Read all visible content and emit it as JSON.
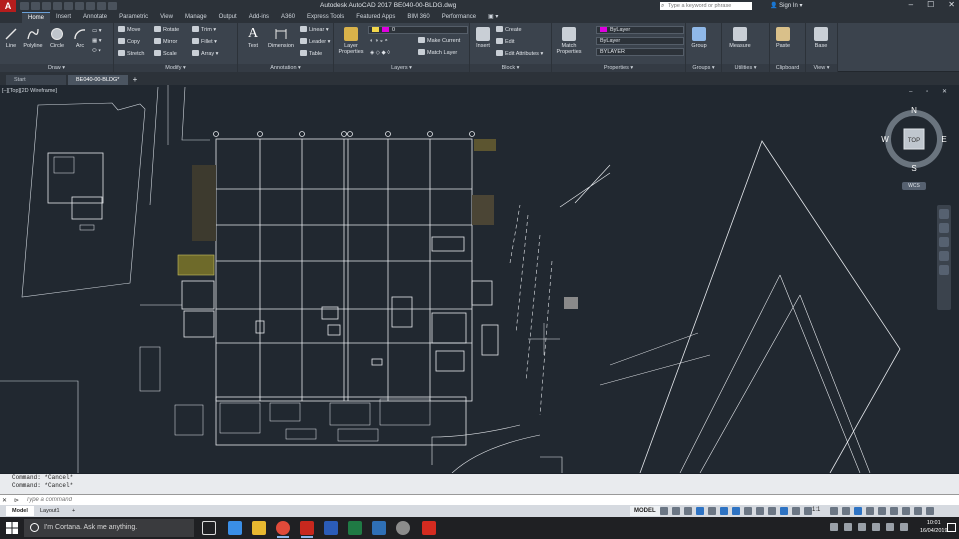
{
  "app": {
    "title": "Autodesk AutoCAD 2017   BE040-00-BLDG.dwg",
    "logo_letter": "A",
    "search_placeholder": "Type a keyword or phrase",
    "sign_in": "Sign In",
    "window_controls": [
      "–",
      "☐",
      "✕"
    ]
  },
  "ribbon_tabs": [
    "Home",
    "Insert",
    "Annotate",
    "Parametric",
    "View",
    "Manage",
    "Output",
    "Add-ins",
    "A360",
    "Express Tools",
    "Featured Apps",
    "BIM 360",
    "Performance",
    "▣ ▾"
  ],
  "ribbon_active_tab": "Home",
  "panels": {
    "draw": {
      "title": "Draw ▾",
      "tools": [
        "Line",
        "Polyline",
        "Circle",
        "Arc"
      ]
    },
    "modify": {
      "title": "Modify ▾",
      "tools": [
        "Move",
        "Rotate",
        "Trim",
        "Copy",
        "Mirror",
        "Fillet",
        "Stretch",
        "Scale",
        "Array"
      ]
    },
    "annotation": {
      "title": "Annotation ▾",
      "big_tools": [
        "Text",
        "Dimension"
      ],
      "tools": [
        "Linear",
        "Leader",
        "Table"
      ]
    },
    "layers": {
      "title": "Layers ▾",
      "big_tool": "Layer Properties",
      "current_layer": "0",
      "tools": [
        "Make Current",
        "Match Layer"
      ]
    },
    "block": {
      "title": "Block ▾",
      "big_tool": "Insert",
      "tools": [
        "Create",
        "Edit",
        "Edit Attributes"
      ]
    },
    "properties": {
      "title": "Properties ▾",
      "big_tool": "Match Properties",
      "color": "ByLayer",
      "linetype": "ByLayer",
      "lineweight": "BYLAYER"
    },
    "groups": {
      "title": "Groups ▾",
      "big_tool": "Group"
    },
    "utilities": {
      "title": "Utilities ▾",
      "big_tool": "Measure"
    },
    "clipboard": {
      "title": "Clipboard",
      "big_tool": "Paste"
    },
    "view": {
      "title": "View ▾",
      "big_tool": "Base"
    }
  },
  "file_tabs": [
    "Start",
    "BE040-00-BLDG*"
  ],
  "file_tab_add": "+",
  "viewport": {
    "label": "[–][Top][2D Wireframe]",
    "controls": "– ▫ ✕",
    "viewcube": {
      "top_face": "TOP",
      "north": "N",
      "south": "S",
      "east": "E",
      "west": "W"
    },
    "wcs": "WCS"
  },
  "command_history": [
    "Command: *Cancel*",
    "Command: *Cancel*"
  ],
  "command_input": {
    "placeholder": "Type a command",
    "close_icon": "✕",
    "prompt_icon": "⊳"
  },
  "layout_tabs": [
    "Model",
    "Layout1",
    "+"
  ],
  "status": {
    "model_button": "MODEL",
    "scale": "1:1"
  },
  "taskbar": {
    "cortana_text": "I'm Cortana. Ask me anything.",
    "time": "10:01",
    "date": "16/04/2019"
  },
  "colors": {
    "accent_blue": "#2e73c3",
    "autocad_red": "#b51d1d",
    "layer_magenta": "#e000e0",
    "canvas_bg": "#212830"
  }
}
